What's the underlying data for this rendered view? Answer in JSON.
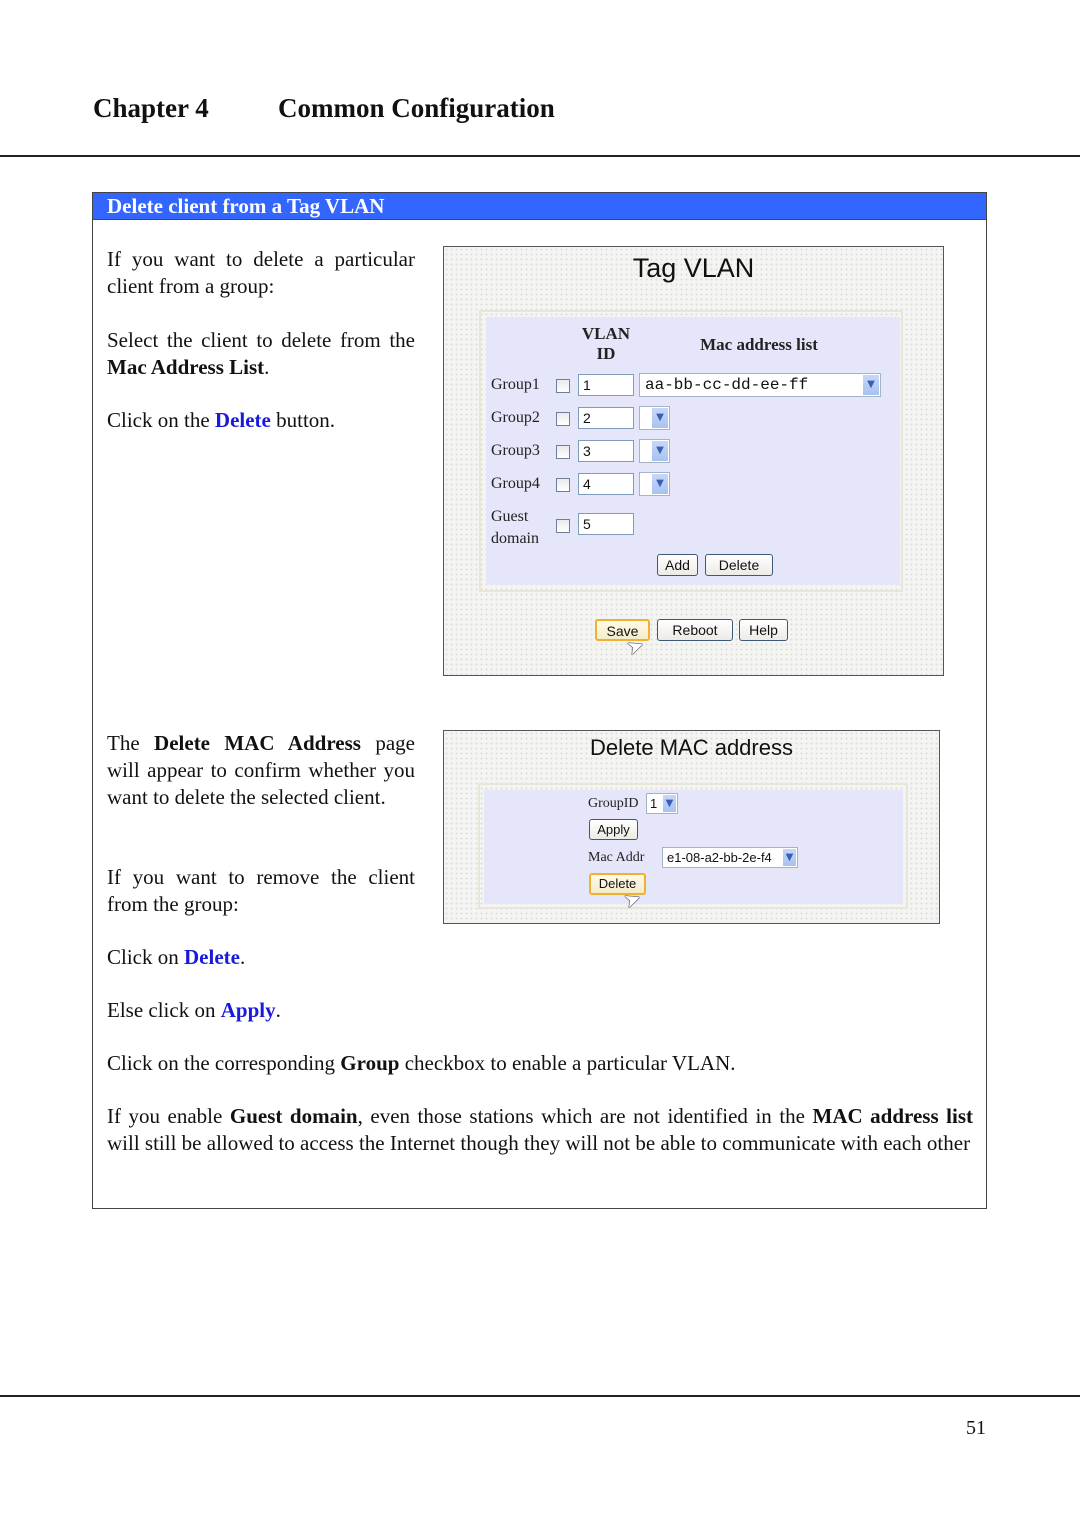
{
  "header": {
    "chapter_label": "Chapter 4",
    "chapter_title": "Common Configuration"
  },
  "panel": {
    "title": "Delete client from a Tag VLAN",
    "intro": {
      "p1": "If you want to delete a particular client from a group:",
      "p2_pre": "Select the client to delete from the ",
      "p2_bold": "Mac Address List",
      "p2_post": ".",
      "p3_pre": "Click on the ",
      "p3_link": "Delete",
      "p3_post": " button."
    },
    "confirm": {
      "p1_pre": "The ",
      "p1_bold": "Delete MAC Address",
      "p1_post": " page will appear to confirm whether you want to delete the selected client.",
      "p2": "If you want to remove the client from the group:",
      "p3_pre": "Click on ",
      "p3_link": "Delete",
      "p3_post": ".",
      "p4_pre": "Else click on ",
      "p4_link": "Apply",
      "p4_post": "."
    },
    "note1_pre": "Click on the corresponding ",
    "note1_bold": "Group",
    "note1_post": " checkbox to enable a particular VLAN.",
    "note2_pre": "If you enable ",
    "note2_bold1": "Guest domain",
    "note2_mid": ", even those stations which are not identified in the ",
    "note2_bold2": "MAC address list",
    "note2_post": " will still be allowed to access the Internet though they will not be able to communicate with each other"
  },
  "tag_vlan": {
    "title": "Tag VLAN",
    "col_vlan_id": "VLAN ID",
    "col_mac_list": "Mac address list",
    "rows": [
      {
        "label": "Group1",
        "checked": false,
        "vlan_id": "1",
        "mac": "aa-bb-cc-dd-ee-ff"
      },
      {
        "label": "Group2",
        "checked": false,
        "vlan_id": "2",
        "mac": ""
      },
      {
        "label": "Group3",
        "checked": false,
        "vlan_id": "3",
        "mac": ""
      },
      {
        "label": "Group4",
        "checked": false,
        "vlan_id": "4",
        "mac": ""
      }
    ],
    "guest_label_1": "Guest",
    "guest_label_2": "domain",
    "guest_checked": false,
    "guest_vlan_id": "5",
    "add_button": "Add",
    "delete_button": "Delete",
    "save_button": "Save",
    "reboot_button": "Reboot",
    "help_button": "Help"
  },
  "delete_mac": {
    "title": "Delete MAC address",
    "group_id_label": "GroupID",
    "group_id_value": "1",
    "apply_button": "Apply",
    "mac_addr_label": "Mac Addr",
    "mac_addr_value": "e1-08-a2-bb-2e-f4",
    "delete_button": "Delete"
  },
  "footer": {
    "page_number": "51"
  },
  "colors": {
    "header_bar": "#3366ff",
    "link_blue": "#1a1adb",
    "form_bg": "#e6e6fa"
  }
}
